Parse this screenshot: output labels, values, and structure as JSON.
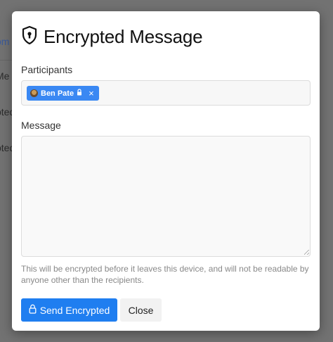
{
  "background": {
    "rows": [
      "om",
      "Me",
      "pted",
      "pted"
    ]
  },
  "modal": {
    "title": "Encrypted Message",
    "title_icon": "shield-keyhole-icon",
    "participants": {
      "label": "Participants",
      "chips": [
        {
          "name": "Ben Pate",
          "icon": "lock-icon",
          "remove_icon": "close-icon"
        }
      ]
    },
    "message": {
      "label": "Message",
      "value": ""
    },
    "help_text": "This will be encrypted before it leaves this device, and will not be readable by anyone other than the recipients.",
    "buttons": {
      "send_label": "Send Encrypted",
      "send_icon": "lock-icon",
      "close_label": "Close"
    }
  },
  "colors": {
    "accent": "#1f7ef0",
    "chip": "#3a88f3",
    "overlay": "#727272"
  }
}
